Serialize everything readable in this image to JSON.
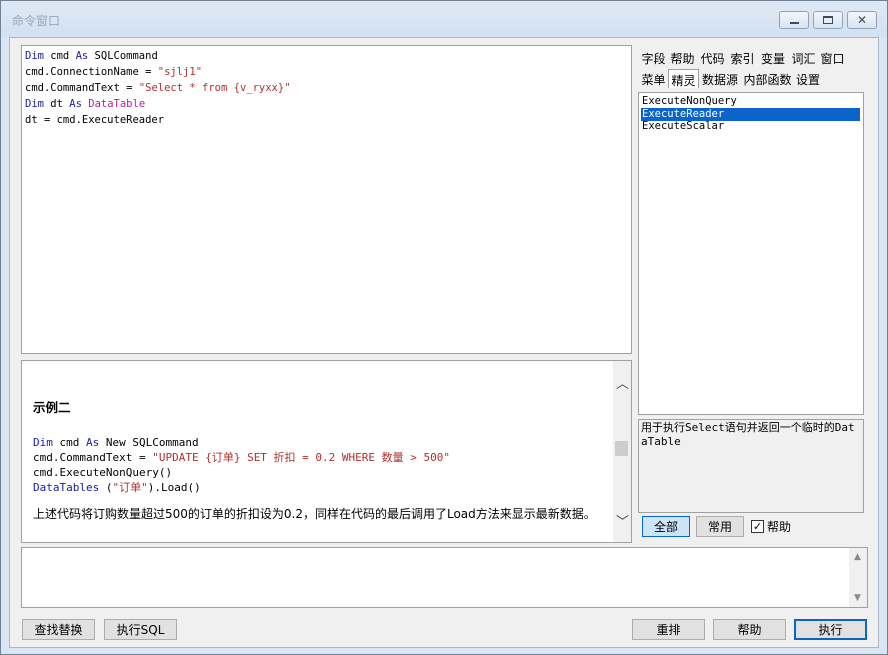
{
  "window": {
    "title": "命令窗口"
  },
  "code_editor": {
    "lines": [
      [
        {
          "t": "Dim",
          "c": "kw"
        },
        {
          "t": " cmd "
        },
        {
          "t": "As",
          "c": "kw"
        },
        {
          "t": " SQLCommand"
        }
      ],
      [
        {
          "t": "cmd.ConnectionName = "
        },
        {
          "t": "\"sjlj1\"",
          "c": "str"
        }
      ],
      [
        {
          "t": "cmd.CommandText = "
        },
        {
          "t": "\"Select * from {v_ryxx}\"",
          "c": "str"
        }
      ],
      [
        {
          "t": "Dim",
          "c": "kw"
        },
        {
          "t": " dt "
        },
        {
          "t": "As",
          "c": "kw"
        },
        {
          "t": " "
        },
        {
          "t": "DataTable",
          "c": "ty"
        }
      ],
      [
        {
          "t": "dt = cmd.ExecuteReader"
        }
      ]
    ]
  },
  "help_pane": {
    "heading": "示例二",
    "code": [
      [
        {
          "t": "Dim",
          "c": "kw"
        },
        {
          "t": " cmd "
        },
        {
          "t": "As",
          "c": "kw"
        },
        {
          "t": " New SQLCommand"
        }
      ],
      [
        {
          "t": "cmd.CommandText = "
        },
        {
          "t": "\"UPDATE {订单} SET 折扣 = 0.2 WHERE 数量 > 500\"",
          "c": "str"
        }
      ],
      [
        {
          "t": "cmd.ExecuteNonQuery()"
        }
      ],
      [
        {
          "t": "DataTables",
          "c": "kw"
        },
        {
          "t": " ("
        },
        {
          "t": "\"订单\"",
          "c": "str"
        },
        {
          "t": ").Load()"
        }
      ]
    ],
    "para1": "上述代码将订购数量超过500的订单的折扣设为0.2，同样在代码的最后调用了Load方法来显示最新数据。"
  },
  "tabs_row1": [
    "字段",
    "帮助",
    "代码",
    "索引",
    "变量",
    "词汇",
    "窗口"
  ],
  "tabs_row2": [
    "菜单",
    "精灵",
    "数据源",
    "内部函数",
    "设置"
  ],
  "selected_tab": "精灵",
  "method_list": [
    "ExecuteNonQuery",
    "ExecuteReader",
    "ExecuteScalar"
  ],
  "selected_method": "ExecuteReader",
  "description": "用于执行Select语句并返回一个临时的DataTable",
  "filter_buttons": {
    "all": "全部",
    "common": "常用"
  },
  "help_checkbox": {
    "label": "帮助",
    "checked": true
  },
  "bottom_buttons": {
    "find_replace": "查找替换",
    "exec_sql": "执行SQL",
    "rearrange": "重排",
    "help": "帮助",
    "execute": "执行"
  },
  "colors": {
    "keyword": "#1a1aa6",
    "string": "#b03030",
    "type": "#b020b0",
    "selection": "#0a64cc"
  }
}
